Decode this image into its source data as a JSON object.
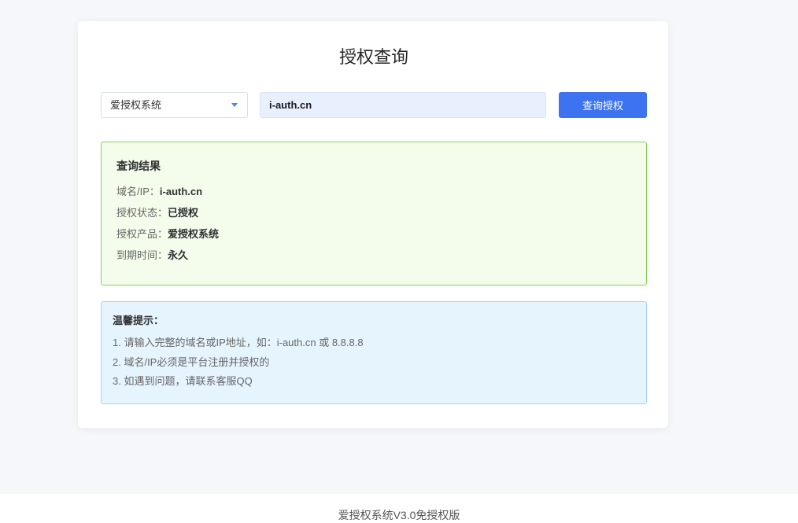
{
  "page": {
    "title": "授权查询",
    "footer": "爱授权系统V3.0免授权版"
  },
  "query": {
    "product_select": {
      "selected": "爱授权系统",
      "icon": "caret-down-icon"
    },
    "domain_input": {
      "value": "i-auth.cn"
    },
    "submit_label": "查询授权"
  },
  "result": {
    "heading": "查询结果",
    "rows": [
      {
        "label": "域名/IP：",
        "value": "i-auth.cn"
      },
      {
        "label": "授权状态：",
        "value": "已授权"
      },
      {
        "label": "授权产品：",
        "value": "爱授权系统"
      },
      {
        "label": "到期时间：",
        "value": "永久"
      }
    ]
  },
  "tips": {
    "heading": "温馨提示：",
    "items": [
      "1. 请输入完整的域名或IP地址，如：i-auth.cn 或 8.8.8.8",
      "2. 域名/IP必须是平台注册并授权的",
      "3. 如遇到问题，请联系客服QQ"
    ]
  },
  "colors": {
    "page_background": "#f5f7fa",
    "accent": "#3d73f0",
    "success_border": "#85cf58",
    "success_background": "#f4fdeb",
    "info_border": "#a5d2f3",
    "info_background": "#e6f4fd"
  }
}
